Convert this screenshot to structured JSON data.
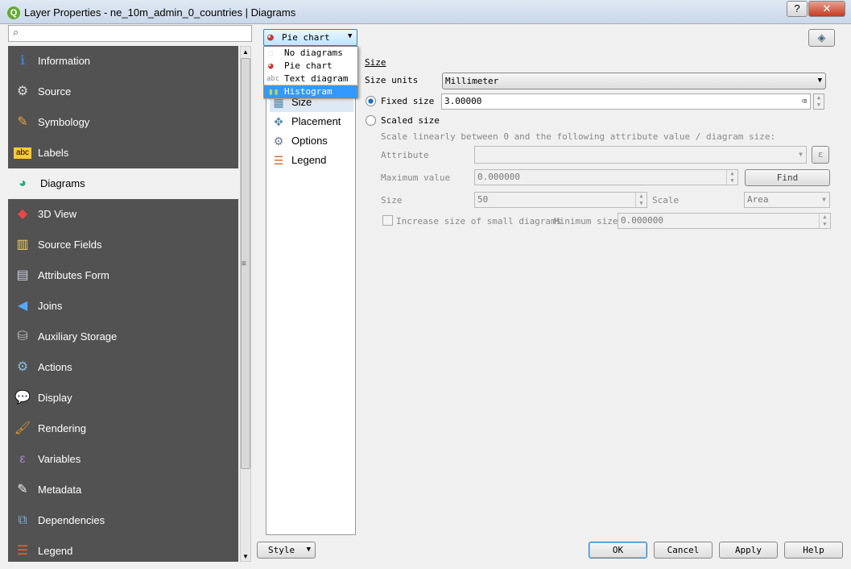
{
  "window": {
    "title": "Layer Properties - ne_10m_admin_0_countries | Diagrams",
    "help": "?",
    "close": "✕"
  },
  "search": {
    "placeholder": ""
  },
  "sidebar": {
    "items": [
      {
        "label": "Information",
        "icon": "information-icon"
      },
      {
        "label": "Source",
        "icon": "source-icon"
      },
      {
        "label": "Symbology",
        "icon": "symbology-icon"
      },
      {
        "label": "Labels",
        "icon": "labels-icon"
      },
      {
        "label": "Diagrams",
        "icon": "diagrams-icon",
        "selected": true
      },
      {
        "label": "3D View",
        "icon": "3d-view-icon"
      },
      {
        "label": "Source Fields",
        "icon": "source-fields-icon"
      },
      {
        "label": "Attributes Form",
        "icon": "attributes-form-icon"
      },
      {
        "label": "Joins",
        "icon": "joins-icon"
      },
      {
        "label": "Auxiliary Storage",
        "icon": "auxiliary-storage-icon"
      },
      {
        "label": "Actions",
        "icon": "actions-icon"
      },
      {
        "label": "Display",
        "icon": "display-icon"
      },
      {
        "label": "Rendering",
        "icon": "rendering-icon"
      },
      {
        "label": "Variables",
        "icon": "variables-icon"
      },
      {
        "label": "Metadata",
        "icon": "metadata-icon"
      },
      {
        "label": "Dependencies",
        "icon": "dependencies-icon"
      },
      {
        "label": "Legend",
        "icon": "legend-icon"
      }
    ]
  },
  "diagram_type": {
    "selected": "Pie chart",
    "options": [
      "No diagrams",
      "Pie chart",
      "Text diagram",
      "Histogram"
    ],
    "highlighted": "Histogram",
    "abc": "abc"
  },
  "subnav": [
    "Size",
    "Placement",
    "Options",
    "Legend"
  ],
  "size": {
    "heading": "Size",
    "units_label": "Size units",
    "units_value": "Millimeter",
    "fixed_label": "Fixed size",
    "fixed_value": "3.00000",
    "fixed_checked": true,
    "scaled_label": "Scaled size",
    "scale_desc": "Scale linearly between 0 and the following attribute value / diagram size:",
    "attribute_label": "Attribute",
    "attribute_value": "",
    "expr": "ε",
    "max_label": "Maximum value",
    "max_value": "0.000000",
    "find": "Find",
    "size_label": "Size",
    "size_value": "50",
    "scale_label": "Scale",
    "scale_value": "Area",
    "increase_label": "Increase size of small diagrams",
    "min_label": "Minimum size",
    "min_value": "0.000000"
  },
  "footer": {
    "style": "Style",
    "ok": "OK",
    "cancel": "Cancel",
    "apply": "Apply",
    "help": "Help"
  }
}
